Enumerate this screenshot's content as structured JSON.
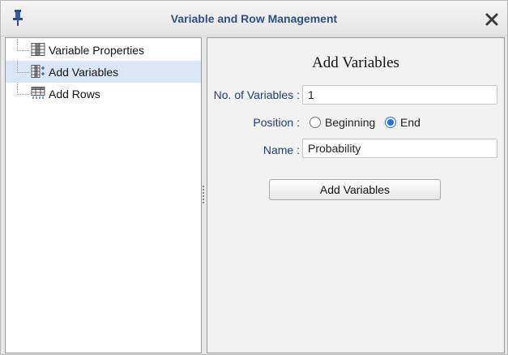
{
  "dialog": {
    "title": "Variable and Row Management"
  },
  "tree": {
    "items": [
      {
        "label": "Variable Properties",
        "icon": "variable-properties-icon"
      },
      {
        "label": "Add Variables",
        "icon": "add-variables-icon",
        "selected": true
      },
      {
        "label": "Add Rows",
        "icon": "add-rows-icon"
      }
    ]
  },
  "form": {
    "title": "Add Variables",
    "num_label": "No. of Variables :",
    "num_value": "1",
    "position_label": "Position :",
    "position_options": [
      "Beginning",
      "End"
    ],
    "position_selected": "End",
    "name_label": "Name :",
    "name_value": "Probability",
    "submit_label": "Add Variables"
  },
  "colors": {
    "title_text": "#2f4f86",
    "selected_row": "#dae6f6",
    "radio_accent": "#1a73e8"
  }
}
